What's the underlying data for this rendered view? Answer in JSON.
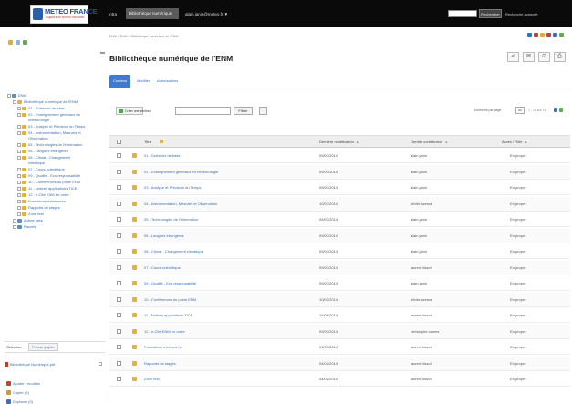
{
  "colors": {
    "topbar": "#0a0a0a",
    "accent": "#3d7bd0",
    "link": "#3b6fb6",
    "folder": "#e3b23c"
  },
  "topbar": {
    "logo_text": "METEO FRANCE",
    "logo_tagline": "Toujours un temps d'avance",
    "nav": [
      "Intra",
      "Bibliothèque numérique",
      "alain.janin@meteo.fr ▼"
    ],
    "search_placeholder": "",
    "search_button": "Rechercher",
    "advanced": "Recherche avancée"
  },
  "sidebar": {
    "tools": [
      "edit-icon",
      "copy-icon",
      "refresh-icon"
    ],
    "tree": [
      {
        "label": "ENM",
        "indent": 0,
        "type": "site"
      },
      {
        "label": "Bibliothèque numérique de l'ENM",
        "indent": 1,
        "type": "folder"
      },
      {
        "label": "01 - Sciences de base",
        "indent": 2,
        "type": "folder"
      },
      {
        "label": "02 - Enseignement généraux en météorologie",
        "indent": 2,
        "type": "folder",
        "lines": [
          "02 - Enseignement généraux en",
          "météorologie"
        ]
      },
      {
        "label": "03 - Analyse et Prévision du Temps",
        "indent": 2,
        "type": "folder"
      },
      {
        "label": "04 - Instrumentation, Mesures et Observation",
        "indent": 2,
        "type": "folder",
        "lines": [
          "04 - Instrumentation, Mesures et",
          "Observation"
        ]
      },
      {
        "label": "05 - Technologies de l'information",
        "indent": 2,
        "type": "folder"
      },
      {
        "label": "06 - Langues étrangères",
        "indent": 2,
        "type": "folder"
      },
      {
        "label": "08 - Climat - Changement climatique",
        "indent": 2,
        "type": "folder",
        "lines": [
          "08 - Climat - Changement",
          "climatique"
        ]
      },
      {
        "label": "07 - Cours scientifique",
        "indent": 2,
        "type": "folder"
      },
      {
        "label": "09 - Qualité - Eco-responsabilité",
        "indent": 2,
        "type": "folder"
      },
      {
        "label": "10 - Conférences du poste ENM",
        "indent": 2,
        "type": "folder"
      },
      {
        "label": "11 - Notices applications TICE",
        "indent": 2,
        "type": "folder"
      },
      {
        "label": "12 - e-Cite ENM en ordre",
        "indent": 2,
        "type": "folder"
      },
      {
        "label": "Formations extérieures",
        "indent": 2,
        "type": "folder"
      },
      {
        "label": "Rapports de stages",
        "indent": 2,
        "type": "folder"
      },
      {
        "label": "Zone test",
        "indent": 2,
        "type": "folder"
      },
      {
        "label": "Autres sites",
        "indent": 1,
        "type": "site"
      },
      {
        "label": "Favoris",
        "indent": 1,
        "type": "site"
      }
    ],
    "panel_label": "Sélection",
    "panel_tab": "Presse-papier",
    "file": "Bibliothèque Numérique.pdf",
    "actions": [
      "Ajouter / modifier",
      "Copier (0)",
      "Déplacer (0)"
    ]
  },
  "breadcrumb": "ENM > ENM > Bibliothèque numérique de l'ENM",
  "page_title": "Bibliothèque numérique de l'ENM",
  "header_actions": [
    "share-icon",
    "mail-icon",
    "rss-icon",
    "print-icon"
  ],
  "tabs": [
    "Contenu",
    "Modifier",
    "Autorisations"
  ],
  "toolbar": {
    "new_button": "Créer une section",
    "filter_value": "",
    "ok_button": "Filtrer",
    "options_icon": "options-icon"
  },
  "pager": {
    "label": "Éléments par page",
    "size": "50",
    "nav": "1 - 18 sur 18"
  },
  "table": {
    "columns": [
      "Titre",
      "Dernière modification",
      "Dernier contributeur",
      "Accès / Rôle"
    ],
    "rows": [
      {
        "title": "01 - Sciences de base",
        "date": "09/07/2014",
        "author": "alain.janin",
        "access": "En propre"
      },
      {
        "title": "02 - Enseignement généraux en météorologie",
        "date": "09/07/2014",
        "author": "alain.janin",
        "access": "En propre"
      },
      {
        "title": "03 - Analyse et Prévision du Temps",
        "date": "09/07/2014",
        "author": "alain.janin",
        "access": "En propre"
      },
      {
        "title": "04 - Instrumentation, Mesures et Observation",
        "date": "10/07/2014",
        "author": "olivier.azema",
        "access": "En propre"
      },
      {
        "title": "05 - Technologies de l'information",
        "date": "09/07/2014",
        "author": "alain.janin",
        "access": "En propre"
      },
      {
        "title": "06 - Langues étrangères",
        "date": "09/07/2014",
        "author": "alain.janin",
        "access": "En propre"
      },
      {
        "title": "08 - Climat - Changement climatique",
        "date": "09/07/2014",
        "author": "alain.janin",
        "access": "En propre"
      },
      {
        "title": "07 - Cours scientifique",
        "date": "09/07/2014",
        "author": "laurent.tissot",
        "access": "En propre"
      },
      {
        "title": "09 - Qualité - Eco-responsabilité",
        "date": "09/07/2014",
        "author": "alain.janin",
        "access": "En propre"
      },
      {
        "title": "10 - Conférences du poste ENM",
        "date": "10/07/2014",
        "author": "olivier.azema",
        "access": "En propre"
      },
      {
        "title": "11 - Notices applications TICE",
        "date": "19/06/2014",
        "author": "laurent.tissot",
        "access": "En propre"
      },
      {
        "title": "12 - e-Cite ENM en ordre",
        "date": "09/07/2014",
        "author": "christophe.cames",
        "access": "En propre"
      },
      {
        "title": "Formations extérieures",
        "date": "09/07/2014",
        "author": "laurent.tissot",
        "access": "En propre"
      },
      {
        "title": "Rapports de stages",
        "date": "04/02/2014",
        "author": "laurent.tissot",
        "access": "En propre"
      },
      {
        "title": "Zone test",
        "date": "04/02/2014",
        "author": "laurent.tissot",
        "access": "En propre"
      }
    ]
  }
}
